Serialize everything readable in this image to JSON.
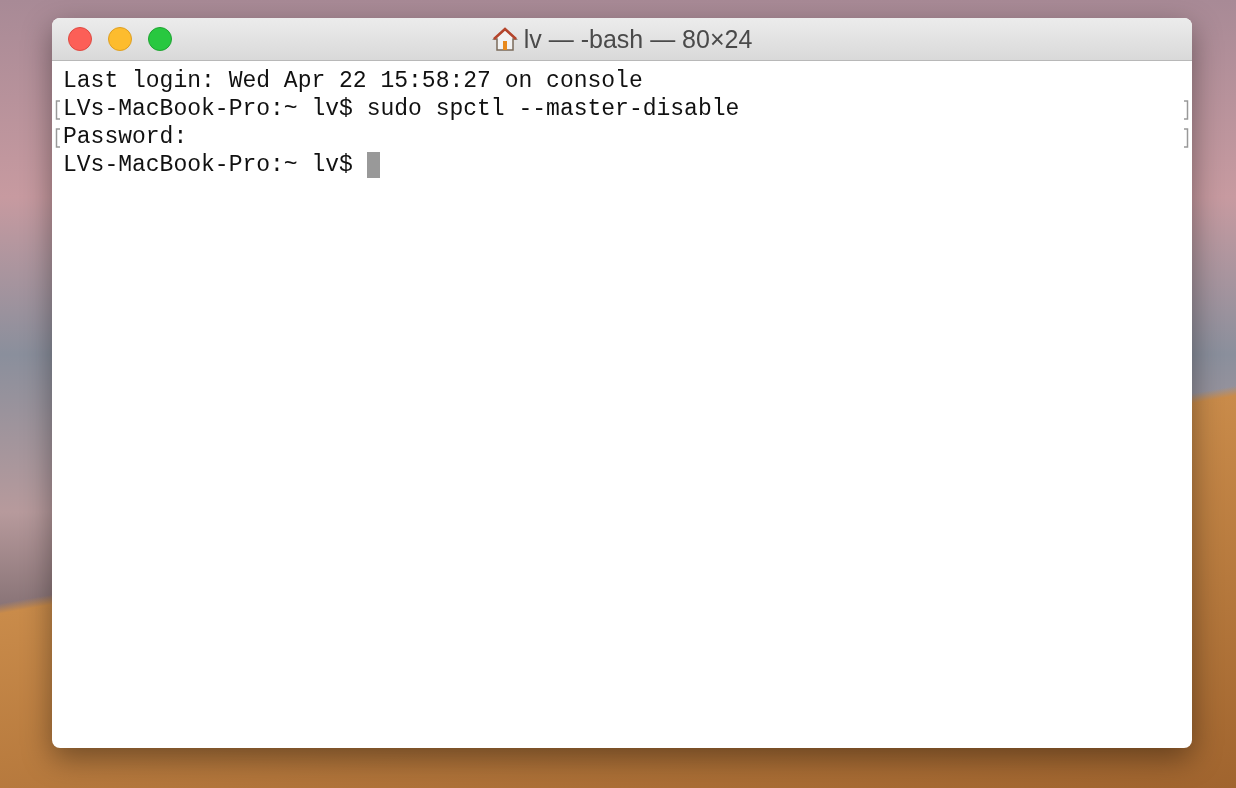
{
  "window": {
    "title": "lv — -bash — 80×24"
  },
  "lines": [
    {
      "text": "Last login: Wed Apr 22 15:58:27 on console",
      "marked": false,
      "cursor": false
    },
    {
      "text": "LVs-MacBook-Pro:~ lv$ sudo spctl --master-disable",
      "marked": true,
      "cursor": false
    },
    {
      "text": "Password:",
      "marked": true,
      "cursor": false
    },
    {
      "text": "LVs-MacBook-Pro:~ lv$ ",
      "marked": false,
      "cursor": true
    }
  ]
}
